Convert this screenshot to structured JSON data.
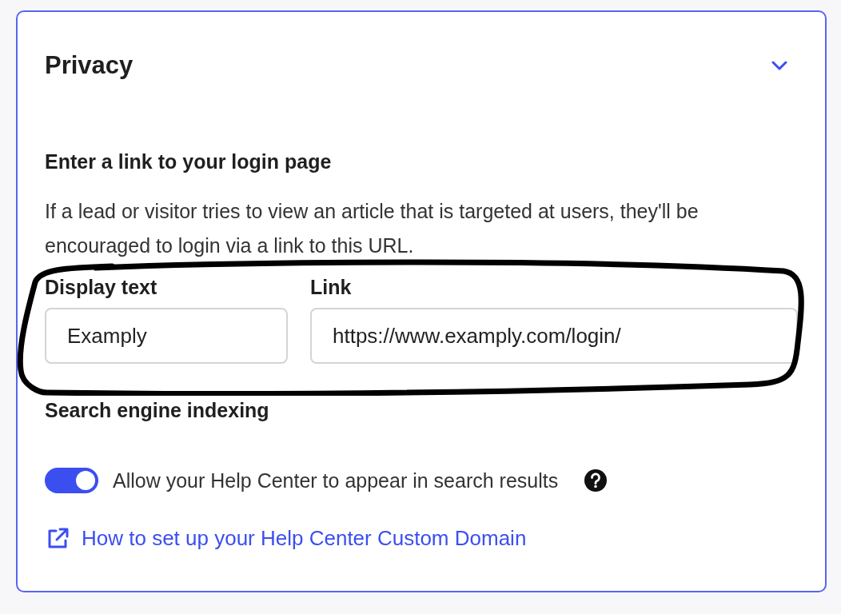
{
  "panel": {
    "title": "Privacy",
    "expanded": true
  },
  "login_link": {
    "heading": "Enter a link to your login page",
    "description": "If a lead or visitor tries to view an article that is targeted at users, they'll be encouraged to login via a link to this URL.",
    "fields": [
      {
        "label": "Display text",
        "value": "Examply"
      },
      {
        "label": "Link",
        "value": "https://www.examply.com/login/"
      }
    ]
  },
  "indexing": {
    "heading": "Search engine indexing",
    "toggle": {
      "label": "Allow your Help Center to appear in search results",
      "on": true
    }
  },
  "help_link": "How to set up your Help Center Custom Domain"
}
